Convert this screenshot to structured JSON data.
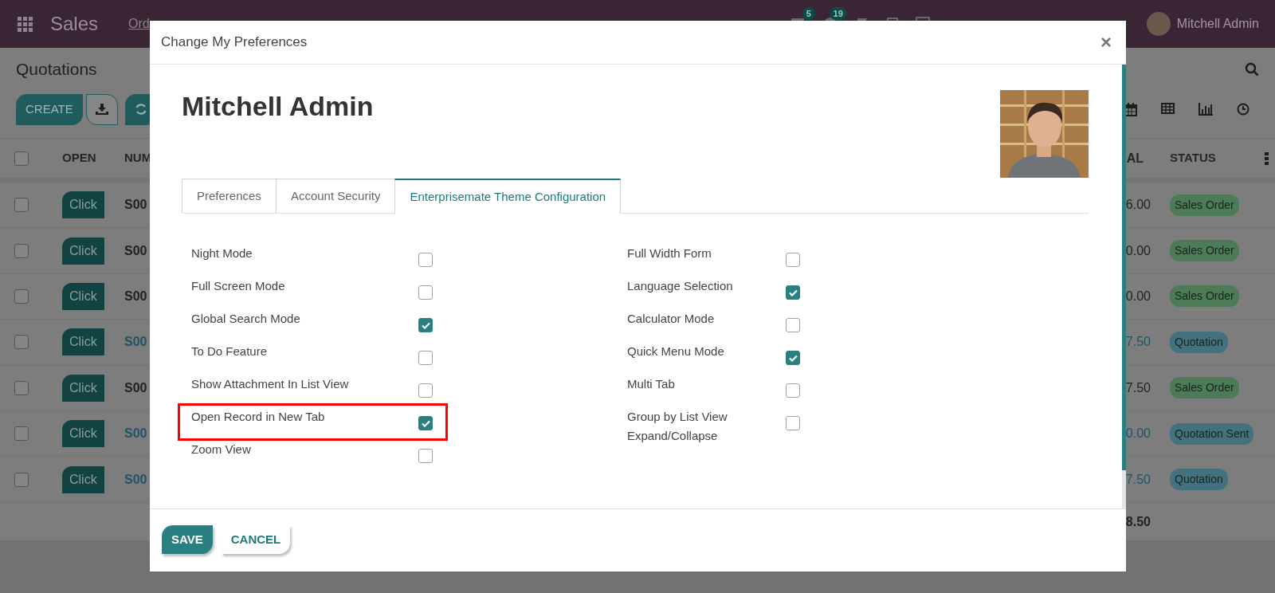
{
  "navbar": {
    "app_name": "Sales",
    "menu": [
      "Ord"
    ],
    "chat_count": "5",
    "activity_count": "19",
    "user": "Mitchell Admin"
  },
  "page": {
    "title": "Quotations",
    "create_label": "CREATE"
  },
  "list": {
    "all_checked": false,
    "columns": [
      "OPEN",
      "NUM",
      "AL",
      "STATUS"
    ],
    "rows": [
      {
        "checked": false,
        "open": "Click",
        "number": "S00",
        "total": "6.00",
        "kind": "plain",
        "status": "Sales Order",
        "color": "#4e7b57"
      },
      {
        "checked": false,
        "open": "Click",
        "number": "S00",
        "total": "0.00",
        "kind": "plain",
        "status": "Sales Order",
        "color": "#4e7b57"
      },
      {
        "checked": false,
        "open": "Click",
        "number": "S00",
        "total": "0.00",
        "kind": "plain",
        "status": "Sales Order",
        "color": "#4e7b57"
      },
      {
        "checked": false,
        "open": "Click",
        "number": "S00",
        "total": "7.50",
        "kind": "link",
        "status": "Quotation",
        "color": "#43727e"
      },
      {
        "checked": false,
        "open": "Click",
        "number": "S00",
        "total": "7.50",
        "kind": "plain",
        "status": "Sales Order",
        "color": "#4e7b57"
      },
      {
        "checked": false,
        "open": "Click",
        "number": "S00",
        "total": "0.00",
        "kind": "link",
        "status": "Quotation Sent",
        "color": "#43727e"
      },
      {
        "checked": false,
        "open": "Click",
        "number": "S00",
        "total": "7.50",
        "kind": "link",
        "status": "Quotation",
        "color": "#43727e"
      }
    ],
    "sum": "8.50"
  },
  "dialog": {
    "title": "Change My Preferences",
    "close": "×",
    "user_name": "Mitchell Admin",
    "tabs": [
      {
        "label": "Preferences",
        "selected": false
      },
      {
        "label": "Account Security",
        "selected": false
      },
      {
        "label": "Enterprisemate Theme Configuration",
        "selected": true
      }
    ],
    "settings_left": [
      {
        "label": "Night Mode",
        "checked": false,
        "highlighted": false
      },
      {
        "label": "Full Screen Mode",
        "checked": false,
        "highlighted": false
      },
      {
        "label": "Global Search Mode",
        "checked": true,
        "highlighted": false
      },
      {
        "label": "To Do Feature",
        "checked": false,
        "highlighted": false
      },
      {
        "label": "Show Attachment In List View",
        "checked": false,
        "highlighted": false
      },
      {
        "label": "Open Record in New Tab",
        "checked": true,
        "highlighted": true
      },
      {
        "label": "Zoom View",
        "checked": false,
        "highlighted": false
      }
    ],
    "settings_right": [
      {
        "label": "Full Width Form",
        "checked": false,
        "highlighted": false
      },
      {
        "label": "Language Selection",
        "checked": true,
        "highlighted": false
      },
      {
        "label": "Calculator Mode",
        "checked": false,
        "highlighted": false
      },
      {
        "label": "Quick Menu Mode",
        "checked": true,
        "highlighted": false
      },
      {
        "label": "Multi Tab",
        "checked": false,
        "highlighted": false
      },
      {
        "label": "Group by List View Expand/Collapse",
        "checked": false,
        "highlighted": false
      }
    ],
    "buttons": [
      {
        "label": "SAVE",
        "kind": "primary"
      },
      {
        "label": "CANCEL",
        "kind": "secondary"
      }
    ]
  }
}
